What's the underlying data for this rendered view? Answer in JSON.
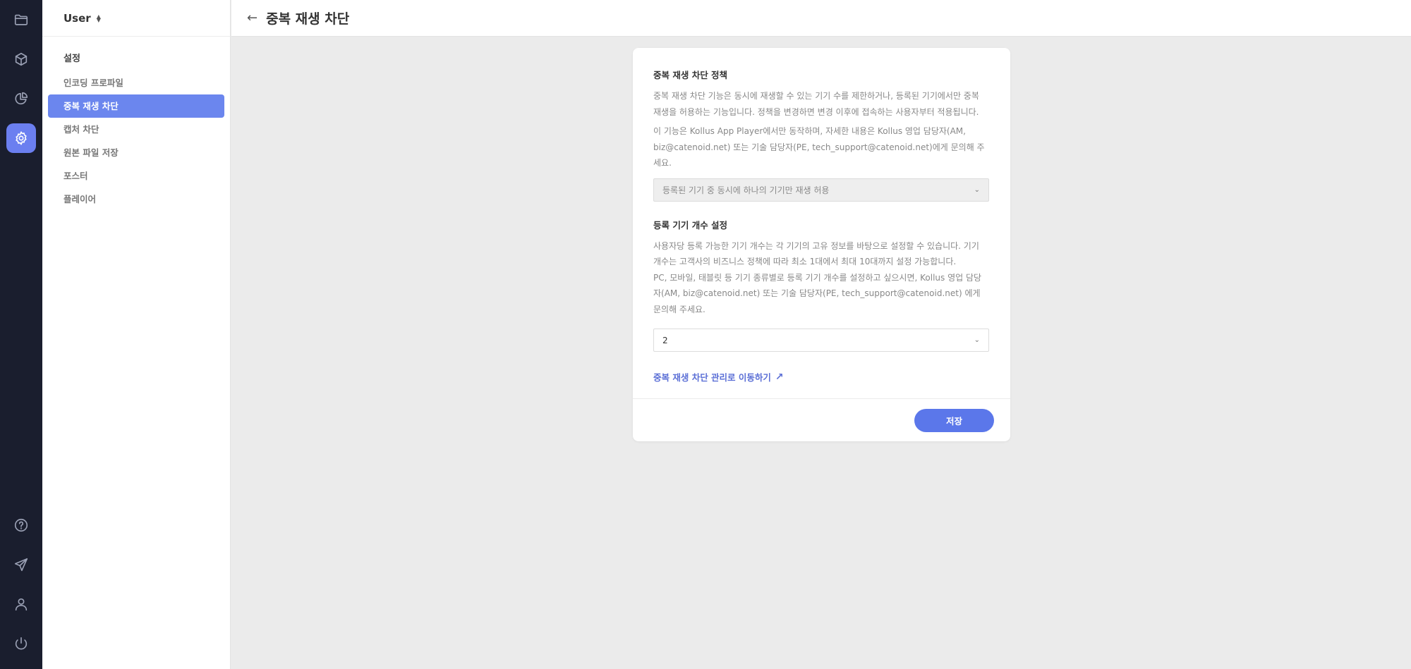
{
  "rail": {
    "icons": [
      "folder-icon",
      "cube-icon",
      "chart-icon",
      "gear-icon",
      "help-icon",
      "send-icon",
      "user-icon",
      "power-icon"
    ],
    "active_color": "#6b7ff0"
  },
  "sidebar": {
    "user_label": "User",
    "section_title": "설정",
    "items": [
      {
        "label": "인코딩 프로파일",
        "active": false
      },
      {
        "label": "중복 재생 차단",
        "active": true
      },
      {
        "label": "캡처 차단",
        "active": false
      },
      {
        "label": "원본 파일 저장",
        "active": false
      },
      {
        "label": "포스터",
        "active": false
      },
      {
        "label": "플레이어",
        "active": false
      }
    ]
  },
  "header": {
    "back_glyph": "←",
    "title": "중복 재생 차단"
  },
  "card": {
    "policy": {
      "title": "중복 재생 차단 정책",
      "desc1": "중복 재생 차단 기능은 동시에 재생할 수 있는 기기 수를 제한하거나, 등록된 기기에서만 중복 재생을 허용하는 기능입니다. 정책을 변경하면 변경 이후에 접속하는 사용자부터 적용됩니다.",
      "desc2": "이 기능은 Kollus App Player에서만 동작하며, 자세한 내용은 Kollus 영업 담당자(AM, biz@catenoid.net) 또는 기술 담당자(PE, tech_support@catenoid.net)에게 문의해 주세요.",
      "select_value": "등록된 기기 중 동시에 하나의 기기만 재생 허용"
    },
    "device_count": {
      "title": "등록 기기 개수 설정",
      "desc1": "사용자당 등록 가능한 기기 개수는 각 기기의 고유 정보를 바탕으로 설정할 수 있습니다. 기기 개수는 고객사의 비즈니스 정책에 따라 최소 1대에서 최대 10대까지 설정 가능합니다.",
      "desc2": "PC, 모바일, 태블릿 등 기기 종류별로 등록 기기 개수를 설정하고 싶으시면, Kollus 영업 담당자(AM, biz@catenoid.net) 또는 기술 담당자(PE, tech_support@catenoid.net) 에게 문의해 주세요.",
      "select_value": "2"
    },
    "manage_link": "중복 재생 차단 관리로 이동하기",
    "manage_link_icon": "↗",
    "save_label": "저장"
  }
}
